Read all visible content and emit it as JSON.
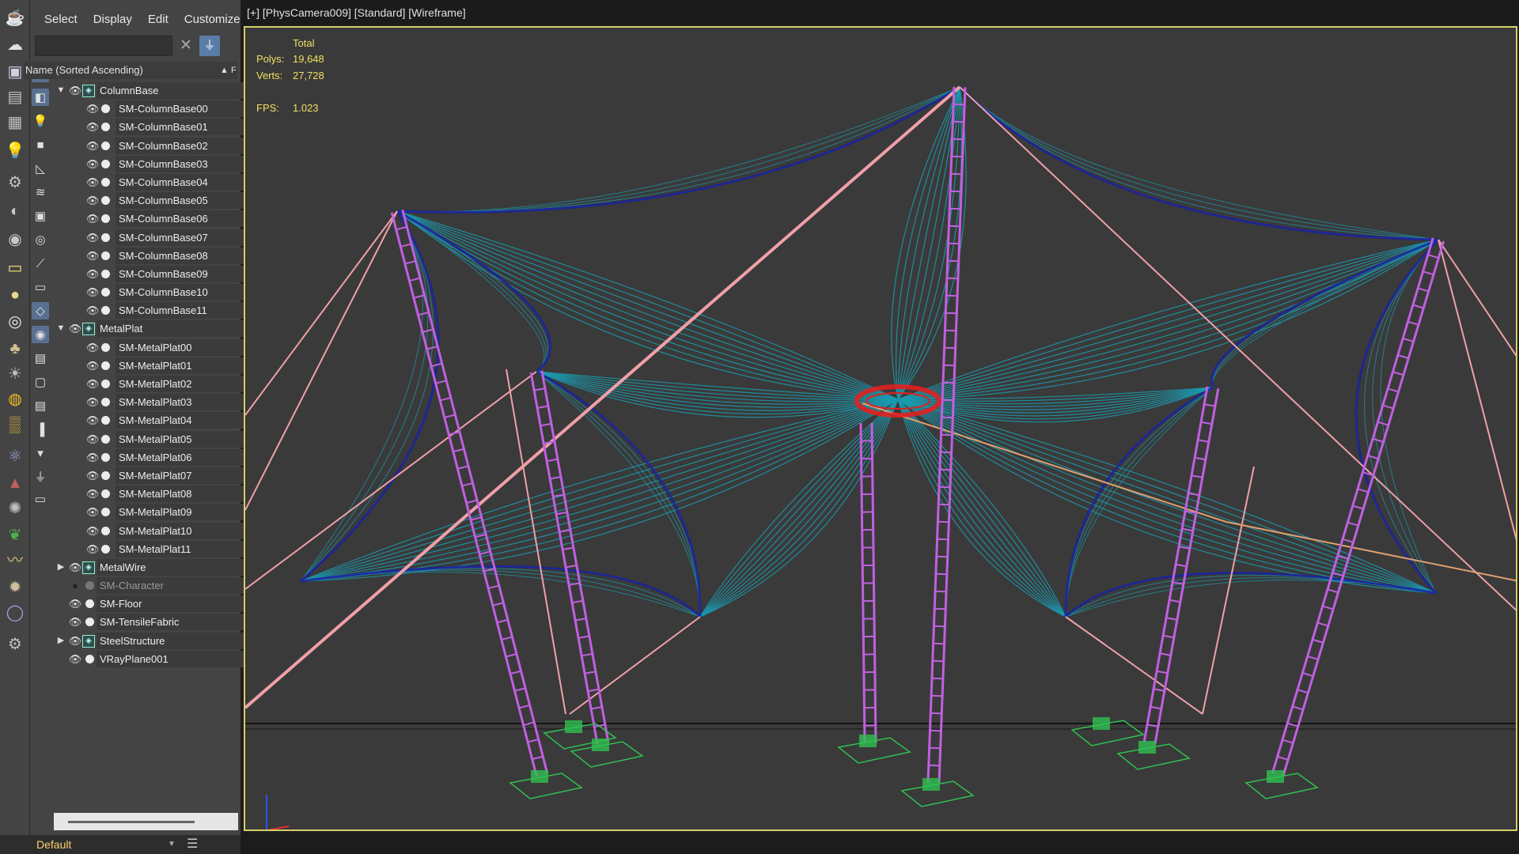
{
  "menu": {
    "items": [
      "Select",
      "Display",
      "Edit",
      "Customize"
    ]
  },
  "search": {
    "value": "",
    "placeholder": ""
  },
  "explorer": {
    "column_header": "Name (Sorted Ascending)",
    "column_extra": "F",
    "rows": [
      {
        "label": "ColumnBase",
        "level": 0,
        "expand": "down",
        "layer": true
      },
      {
        "label": "SM-ColumnBase00",
        "level": 1
      },
      {
        "label": "SM-ColumnBase01",
        "level": 1
      },
      {
        "label": "SM-ColumnBase02",
        "level": 1
      },
      {
        "label": "SM-ColumnBase03",
        "level": 1
      },
      {
        "label": "SM-ColumnBase04",
        "level": 1
      },
      {
        "label": "SM-ColumnBase05",
        "level": 1
      },
      {
        "label": "SM-ColumnBase06",
        "level": 1
      },
      {
        "label": "SM-ColumnBase07",
        "level": 1
      },
      {
        "label": "SM-ColumnBase08",
        "level": 1
      },
      {
        "label": "SM-ColumnBase09",
        "level": 1
      },
      {
        "label": "SM-ColumnBase10",
        "level": 1
      },
      {
        "label": "SM-ColumnBase11",
        "level": 1
      },
      {
        "label": "MetalPlat",
        "level": 0,
        "expand": "down",
        "layer": true
      },
      {
        "label": "SM-MetalPlat00",
        "level": 1
      },
      {
        "label": "SM-MetalPlat01",
        "level": 1
      },
      {
        "label": "SM-MetalPlat02",
        "level": 1
      },
      {
        "label": "SM-MetalPlat03",
        "level": 1
      },
      {
        "label": "SM-MetalPlat04",
        "level": 1
      },
      {
        "label": "SM-MetalPlat05",
        "level": 1
      },
      {
        "label": "SM-MetalPlat06",
        "level": 1
      },
      {
        "label": "SM-MetalPlat07",
        "level": 1
      },
      {
        "label": "SM-MetalPlat08",
        "level": 1
      },
      {
        "label": "SM-MetalPlat09",
        "level": 1
      },
      {
        "label": "SM-MetalPlat10",
        "level": 1
      },
      {
        "label": "SM-MetalPlat11",
        "level": 1
      },
      {
        "label": "MetalWire",
        "level": 0,
        "expand": "right",
        "layer": true
      },
      {
        "label": "SM-Character",
        "level": 0,
        "hidden": true
      },
      {
        "label": "SM-Floor",
        "level": 0
      },
      {
        "label": "SM-TensileFabric",
        "level": 0
      },
      {
        "label": "SteelStructure",
        "level": 0,
        "expand": "right",
        "layer": true
      },
      {
        "label": "VRayPlane001",
        "level": 0
      }
    ]
  },
  "layer": {
    "current": "Default"
  },
  "viewport": {
    "label": "[+] [PhysCamera009] [Standard] [Wireframe]",
    "stats": {
      "total_label": "Total",
      "polys_label": "Polys:",
      "polys_value": "19,648",
      "verts_label": "Verts:",
      "verts_value": "27,728",
      "fps_label": "FPS:",
      "fps_value": "1.023"
    }
  },
  "colors": {
    "fabric": "#1a9bb0",
    "fabric_edge": "#1a1aa0",
    "mast": "#c060e0",
    "cable": "#f0a0a8",
    "base": "#30c050",
    "ring": "#e02020",
    "viewport_border": "#d6d06a",
    "stats_text": "#f0e060"
  },
  "icons": {
    "toolbar": [
      "teapot-icon",
      "cloud-icon",
      "render-frame-icon",
      "render-setup-icon",
      "table-icon",
      "light-lister-icon",
      "camera-icon",
      "mirror-icon",
      "render-camera-icon",
      "material-editor-icon",
      "sphere-icon",
      "globe-icon",
      "grass-icon",
      "sun-icon",
      "orb-icon",
      "grid-icon",
      "molecule-icon",
      "cone-icon",
      "gear-sphere-icon",
      "plant-icon",
      "hair-icon",
      "bomb-icon",
      "sky-sphere-icon",
      "settings-icon"
    ],
    "toolbar2": [
      "sphere-filter-icon",
      "shape-filter-icon",
      "light-filter-icon",
      "camera-filter-icon",
      "helper-filter-icon",
      "spacewarp-filter-icon",
      "group-filter-icon",
      "xref-filter-icon",
      "bone-filter-icon",
      "container-filter-icon",
      "frozen-filter-icon",
      "hidden-filter-icon",
      "all-filter-icon",
      "none-filter-icon",
      "invert-filter-icon",
      "layer-filter-icon",
      "hierarchy-filter-icon",
      "funnel-icon",
      "window-icon"
    ]
  }
}
